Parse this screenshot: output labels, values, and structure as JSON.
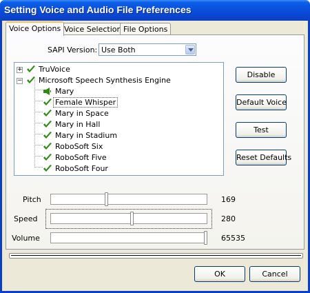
{
  "window": {
    "title": "Setting Voice and Audio File Preferences"
  },
  "tabs": [
    {
      "label": "Voice Options",
      "active": true
    },
    {
      "label": "Voice Selection",
      "active": false
    },
    {
      "label": "File Options",
      "active": false
    }
  ],
  "sapi": {
    "label": "SAPI Version:",
    "value": "Use Both"
  },
  "tree": {
    "roots": [
      {
        "label": "TruVoice",
        "expanded": false
      },
      {
        "label": "Microsoft Speech Synthesis Engine",
        "expanded": true
      }
    ],
    "voices": [
      "Mary",
      "Female Whisper",
      "Mary in Space",
      "Mary in Hall",
      "Mary in Stadium",
      "RoboSoft Six",
      "RoboSoft Five",
      "RoboSoft Four"
    ],
    "selected_voice": "Female Whisper"
  },
  "buttons": {
    "disable": "Disable",
    "default_voice": "Default Voice",
    "test": "Test",
    "reset_defaults": "Reset Defaults",
    "ok": "OK",
    "cancel": "Cancel"
  },
  "sliders": {
    "pitch": {
      "label": "Pitch",
      "value": "169",
      "level": 0.35
    },
    "speed": {
      "label": "Speed",
      "value": "280",
      "level": 0.52
    },
    "volume": {
      "label": "Volume",
      "value": "65535",
      "level": 1.0
    }
  },
  "colors": {
    "titlebar": "#0a50dc",
    "check": "#2e8a13",
    "dialog_bg": "#ece9d8"
  },
  "icons": {
    "check": "green-checkmark-icon",
    "speaker": "speaker-icon",
    "expander": "tree-expander-icon"
  }
}
